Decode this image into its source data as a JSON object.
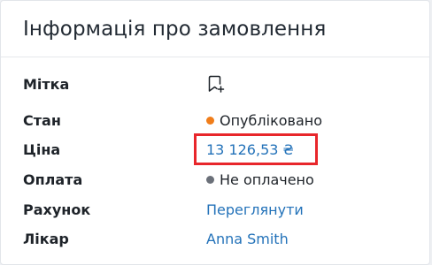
{
  "title": "Інформація про замовлення",
  "rows": [
    {
      "label": "Мітка",
      "icon": "bookmark-plus-icon"
    },
    {
      "label": "Стан",
      "value": "Опубліковано",
      "dot_color": "#f07d1a"
    },
    {
      "label": "Ціна",
      "value": "13 126,53 ₴"
    },
    {
      "label": "Оплата",
      "value": "Не оплачено",
      "dot_color": "#6b7079"
    },
    {
      "label": "Рахунок",
      "value": "Переглянути"
    },
    {
      "label": "Лікар",
      "value": "Anna Smith"
    }
  ],
  "colors": {
    "link": "#2372b9",
    "highlight": "#e8262b"
  }
}
